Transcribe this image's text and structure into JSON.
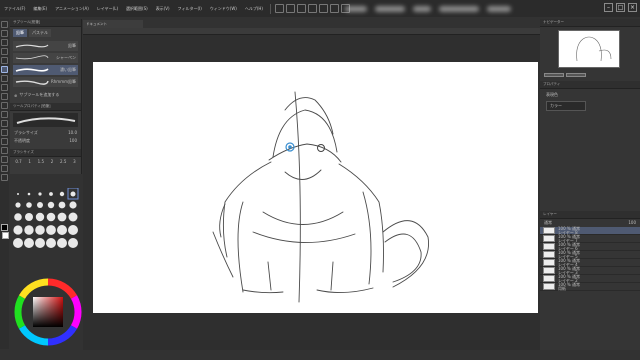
{
  "menu": [
    "ファイル(F)",
    "編集(E)",
    "アニメーション(A)",
    "レイヤー(L)",
    "選択範囲(S)",
    "表示(V)",
    "フィルター(I)",
    "ウィンドウ(W)",
    "ヘルプ(H)"
  ],
  "subtool": {
    "header": "サブツール[鉛筆]",
    "tabs": [
      "鉛筆",
      "パステル"
    ],
    "brushes": [
      "鉛筆",
      "シャーペン",
      "濃い鉛筆",
      "Rhmmm鉛筆"
    ],
    "add_label": "サブツールを追加する",
    "props_header": "ツールプロパティ[鉛筆]",
    "brush_size_label": "ブラシサイズ",
    "brush_size_value": "10.0",
    "opacity_label": "不透明度",
    "opacity_value": "100",
    "brush_panel_header": "ブラシサイズ",
    "size_presets": [
      "0.7",
      "1",
      "1.5",
      "2",
      "2.5",
      "3"
    ]
  },
  "document": {
    "tab_label": "ドキュメント"
  },
  "right": {
    "navigator_header": "ナビゲーター",
    "property_label": "プロパティ",
    "layer_prop_label": "表現色",
    "color_select": "カラー",
    "layer_panel_header": "レイヤー",
    "blend_mode": "通常",
    "opacity_value": "100",
    "layers": [
      {
        "line1": "100 % 通常",
        "line2": "レイヤー 8"
      },
      {
        "line1": "100 % 通常",
        "line2": "レイヤー 7"
      },
      {
        "line1": "100 % 通常",
        "line2": "レイヤー 6"
      },
      {
        "line1": "100 % 通常",
        "line2": "レイヤー 5"
      },
      {
        "line1": "100 % 通常",
        "line2": "レイヤー 4"
      },
      {
        "line1": "100 % 通常",
        "line2": "レイヤー 3"
      },
      {
        "line1": "100 % 通常",
        "line2": "レイヤー 2"
      },
      {
        "line1": "100 % 通常",
        "line2": "用紙"
      }
    ]
  },
  "colors": {
    "main": "#000000",
    "sub": "#ffffff",
    "accent": "#4a7bd1"
  }
}
